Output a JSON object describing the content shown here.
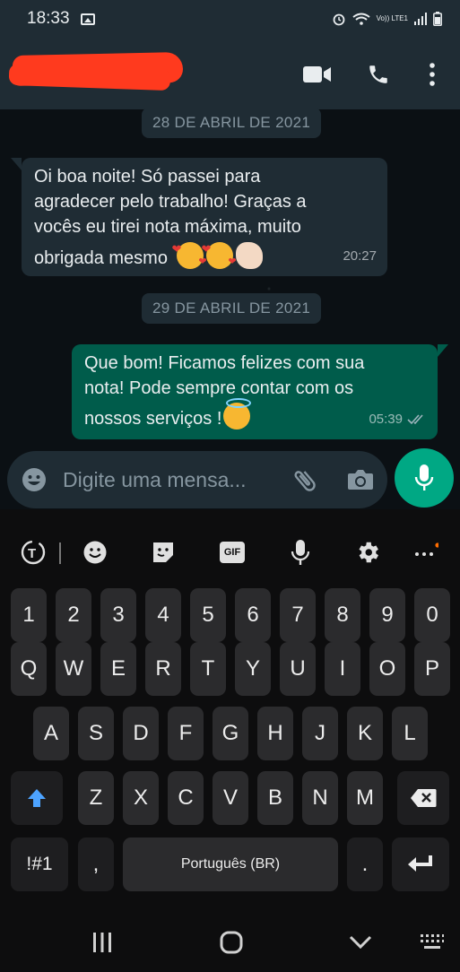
{
  "status_bar": {
    "time": "18:33",
    "network": "Vo)) LTE1"
  },
  "header": {
    "contact_name_redacted": true,
    "icons": [
      "video-call-icon",
      "voice-call-icon",
      "more-options-icon"
    ]
  },
  "chat": {
    "date_1": "28 DE ABRIL DE 2021",
    "msg_1": {
      "line1": "Oi boa noite! Só passei para",
      "line2": "agradecer pelo trabalho! Graças a",
      "line3": "vocês eu tirei nota máxima, muito",
      "line4": "obrigada mesmo",
      "time": "20:27"
    },
    "date_2": "29 DE ABRIL DE 2021",
    "msg_2": {
      "line1": "Que bom! Ficamos felizes com sua",
      "line2": "nota! Pode sempre contar com os",
      "line3": "nossos serviços !",
      "time": "05:39",
      "status": "read"
    }
  },
  "composer": {
    "placeholder": "Digite uma mensa..."
  },
  "keyboard": {
    "numbers": [
      "1",
      "2",
      "3",
      "4",
      "5",
      "6",
      "7",
      "8",
      "9",
      "0"
    ],
    "row1": [
      "Q",
      "W",
      "E",
      "R",
      "T",
      "Y",
      "U",
      "I",
      "O",
      "P"
    ],
    "row2": [
      "A",
      "S",
      "D",
      "F",
      "G",
      "H",
      "J",
      "K",
      "L"
    ],
    "row3": [
      "Z",
      "X",
      "C",
      "V",
      "B",
      "N",
      "M"
    ],
    "symbols": "!#1",
    "comma": ",",
    "space": "Português (BR)",
    "period": ".",
    "gif": "GIF"
  },
  "colors": {
    "accent": "#00a884",
    "outgoing": "#005c4b",
    "incoming": "#1f2c34",
    "redaction": "#ff3a1e"
  }
}
